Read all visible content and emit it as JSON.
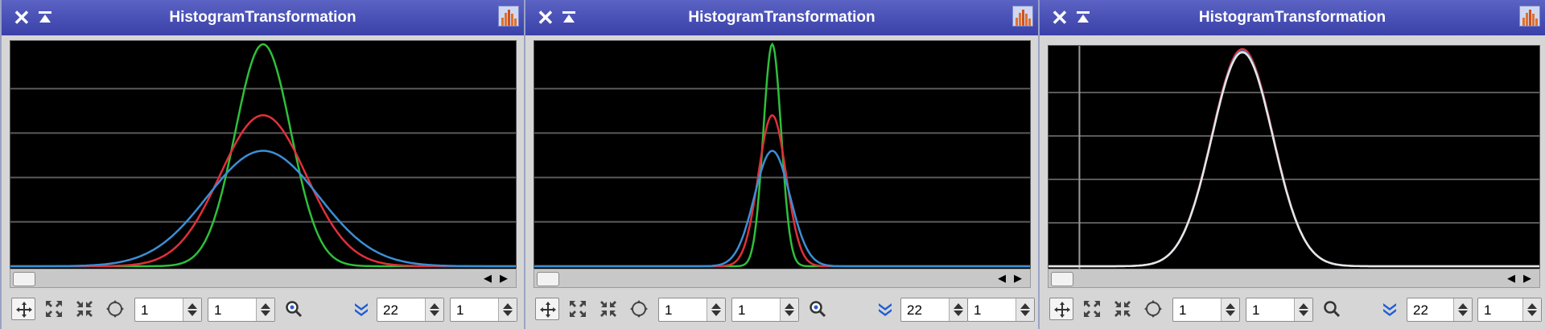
{
  "colors": {
    "red": "#e0303a",
    "green": "#2fbf3a",
    "blue": "#3b8fd6",
    "combined": "#e6e6e6",
    "titlebar": "#4a51b8",
    "grid": "#5a5a5a"
  },
  "windows": [
    {
      "title": "HistogramTransformation",
      "close_icon": "close-icon",
      "shade_icon": "shade-icon",
      "app_icon": "histogram-app-icon",
      "zoom_x": "1",
      "zoom_y": "1",
      "channel_display": "22",
      "last_value": "1",
      "chart_data": {
        "type": "line",
        "series": [
          {
            "color": "green",
            "center": 0.5,
            "sigma": 0.055,
            "peak": 1.0
          },
          {
            "color": "red",
            "center": 0.5,
            "sigma": 0.085,
            "peak": 0.68
          },
          {
            "color": "blue",
            "center": 0.5,
            "sigma": 0.11,
            "peak": 0.52
          }
        ],
        "grid": true,
        "vertical_marker": null
      }
    },
    {
      "title": "HistogramTransformation",
      "close_icon": "close-icon",
      "shade_icon": "shade-icon",
      "app_icon": "histogram-app-icon",
      "zoom_x": "1",
      "zoom_y": "1",
      "channel_display": "22",
      "last_value": "1",
      "chart_data": {
        "type": "line",
        "series": [
          {
            "color": "green",
            "center": 0.48,
            "sigma": 0.018,
            "peak": 1.0
          },
          {
            "color": "red",
            "center": 0.48,
            "sigma": 0.028,
            "peak": 0.68
          },
          {
            "color": "blue",
            "center": 0.48,
            "sigma": 0.036,
            "peak": 0.52
          }
        ],
        "grid": true,
        "vertical_marker": null
      }
    },
    {
      "title": "HistogramTransformation",
      "close_icon": "close-icon",
      "shade_icon": "shade-icon",
      "app_icon": "histogram-app-icon",
      "zoom_x": "1",
      "zoom_y": "1",
      "channel_display": "22",
      "last_value": "1",
      "chart_data": {
        "type": "line",
        "series": [
          {
            "color": "red",
            "center": 0.395,
            "sigma": 0.062,
            "peak": 1.0
          },
          {
            "color": "blue",
            "center": 0.395,
            "sigma": 0.062,
            "peak": 0.99
          },
          {
            "color": "combined",
            "center": 0.395,
            "sigma": 0.062,
            "peak": 0.985
          }
        ],
        "grid": true,
        "vertical_marker": 0.063
      }
    }
  ]
}
